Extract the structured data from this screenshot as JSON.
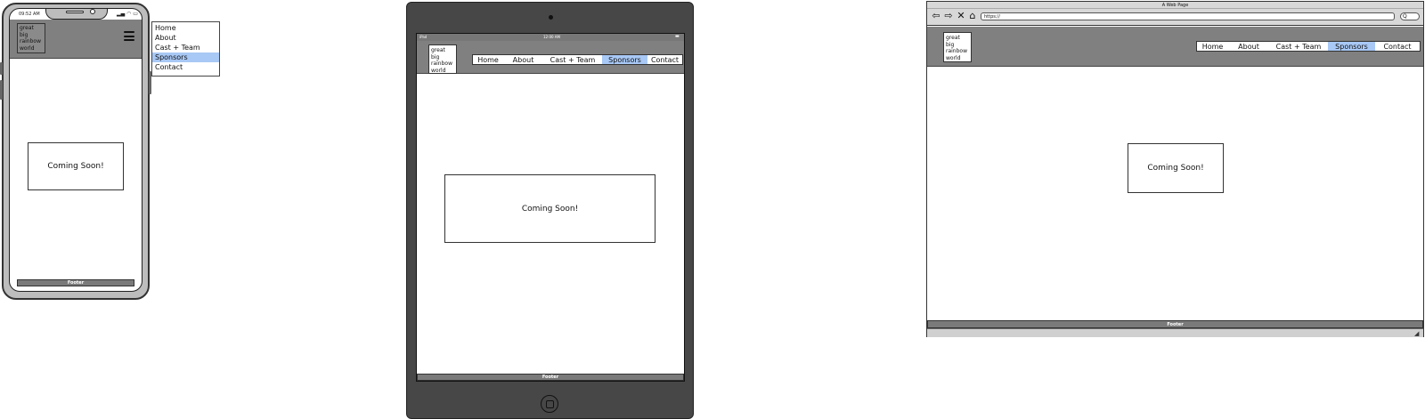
{
  "logo": {
    "lines": [
      "great",
      "big",
      "rainbow",
      "world"
    ]
  },
  "nav": {
    "items": [
      {
        "label": "Home"
      },
      {
        "label": "About"
      },
      {
        "label": "Cast + Team"
      },
      {
        "label": "Sponsors",
        "selected": true
      },
      {
        "label": "Contact"
      }
    ]
  },
  "content": {
    "coming_soon": "Coming Soon!"
  },
  "footer": {
    "label": "Footer"
  },
  "phone": {
    "status_time": "09:52 AM"
  },
  "tablet": {
    "status_left": "iPad",
    "status_time": "12:00 AM"
  },
  "browser": {
    "title": "A Web Page",
    "url": "https://",
    "search_glyph": "Q"
  },
  "colors": {
    "header_gray": "#808080",
    "selected_blue": "#a8c8f5",
    "tablet_body": "#474747"
  }
}
